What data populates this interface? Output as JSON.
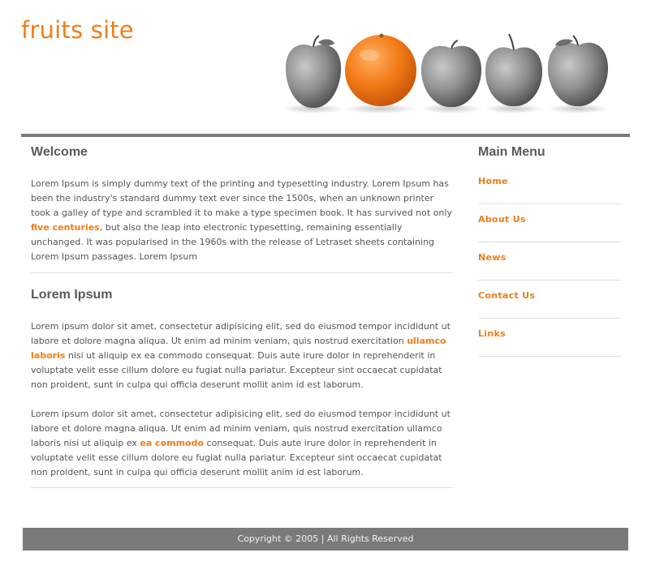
{
  "site": {
    "title": "fruits site"
  },
  "banner": {
    "items": [
      {
        "icon": "apple-icon",
        "color": "#8c8c8c"
      },
      {
        "icon": "orange-icon",
        "color": "#f27a16"
      },
      {
        "icon": "apple-icon",
        "color": "#8c8c8c"
      },
      {
        "icon": "apple-icon",
        "color": "#8c8c8c"
      },
      {
        "icon": "apple-icon",
        "color": "#8c8c8c"
      }
    ]
  },
  "content": {
    "welcome": {
      "heading": "Welcome",
      "p1_a": "Lorem Ipsum is simply dummy text of the printing and typesetting industry. Lorem Ipsum has been the industry's standard dummy text ever since the 1500s, when an unknown printer took a galley of type and scrambled it to make a type specimen book. It has survived not only ",
      "p1_link": "five centuries",
      "p1_b": ", but also the leap into electronic typesetting, remaining essentially unchanged. It was popularised in the 1960s with the release of Letraset sheets containing Lorem Ipsum passages. Lorem Ipsum"
    },
    "lorem": {
      "heading": "Lorem Ipsum",
      "p1_a": "Lorem ipsum dolor sit amet, consectetur adipisicing elit, sed do eiusmod tempor incididunt ut labore et dolore magna aliqua. Ut enim ad minim veniam, quis nostrud exercitation ",
      "p1_link": "ullamco laboris",
      "p1_b": " nisi ut aliquip ex ea commodo consequat. Duis aute irure dolor in reprehenderit in voluptate velit esse cillum dolore eu fugiat nulla pariatur. Excepteur sint occaecat cupidatat non proident, sunt in culpa qui officia deserunt mollit anim id est laborum.",
      "p2_a": "Lorem ipsum dolor sit amet, consectetur adipisicing elit, sed do eiusmod tempor incididunt ut labore et dolore magna aliqua. Ut enim ad minim veniam, quis nostrud exercitation ullamco laboris nisi ut aliquip ex ",
      "p2_link": "ea commodo",
      "p2_b": " consequat. Duis aute irure dolor in reprehenderit in voluptate velit esse cillum dolore eu fugiat nulla pariatur. Excepteur sint occaecat cupidatat non proident, sunt in culpa qui officia deserunt mollit anim id est laborum."
    }
  },
  "sidebar": {
    "heading": "Main Menu",
    "items": [
      {
        "label": "Home"
      },
      {
        "label": "About Us"
      },
      {
        "label": "News"
      },
      {
        "label": "Contact Us"
      },
      {
        "label": "Links"
      }
    ]
  },
  "footer": {
    "text": "Copyright © 2005 | All Rights Reserved"
  },
  "colors": {
    "accent": "#f07e1a",
    "bar": "#7a7a7a",
    "text": "#555555",
    "divider": "#dedede"
  }
}
